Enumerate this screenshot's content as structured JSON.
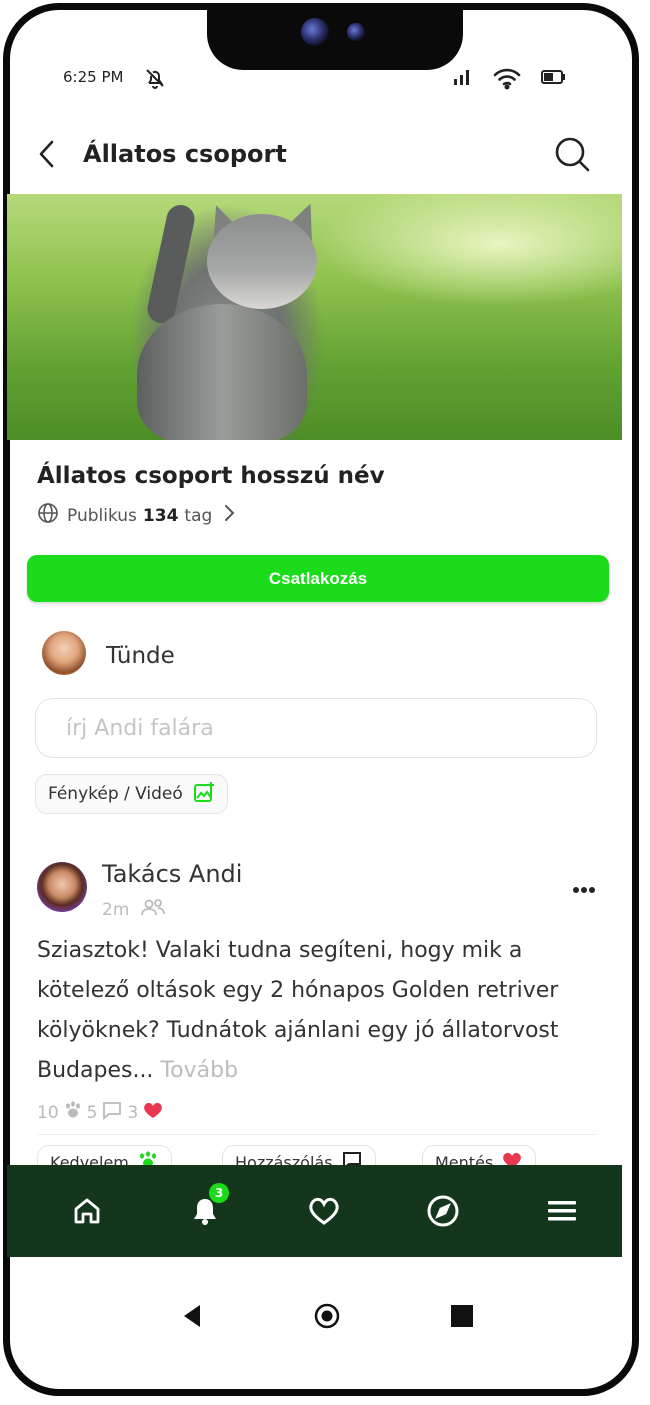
{
  "status_bar": {
    "time": "6:25 PM"
  },
  "header": {
    "title": "Állatos csoport"
  },
  "group": {
    "name": "Állatos csoport hosszú név",
    "privacy": "Publikus",
    "member_count": "134",
    "member_label": "tag"
  },
  "join_button": "Csatlakozás",
  "composer": {
    "user_name": "Tünde",
    "placeholder": "írj Andi falára",
    "media_button": "Fénykép / Videó"
  },
  "post": {
    "author": "Takács Andi",
    "time": "2m",
    "body": "Sziasztok! Valaki tudna segíteni, hogy mik a kötelező oltások egy 2 hónapos Golden retriver kölyöknek? Tudnátok ajánlani egy jó állatorvost Budapes...",
    "more_link": "Tovább",
    "paw_count": "10",
    "comment_count": "5",
    "like_count": "3",
    "actions": [
      "Kedvelem",
      "Hozzászólás",
      "Mentés"
    ]
  },
  "bottom_nav": {
    "items": [
      "home-icon",
      "bell-icon",
      "heart-icon",
      "compass-icon",
      "menu-icon"
    ],
    "notification_badge": "3"
  },
  "colors": {
    "accent": "#1bdc1b",
    "nav_bg": "#14361c",
    "like_red": "#e8384f"
  }
}
